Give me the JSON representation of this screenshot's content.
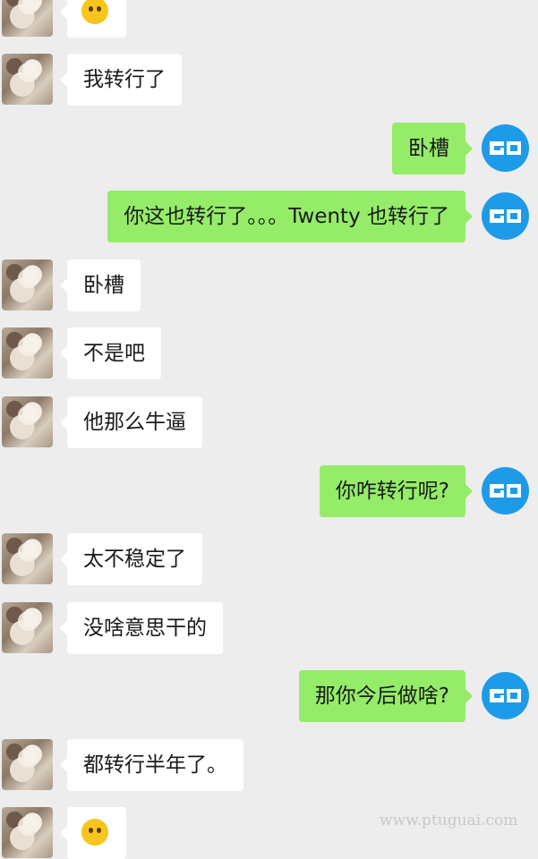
{
  "colors": {
    "background": "#ededed",
    "friend_bubble": "#ffffff",
    "my_bubble": "#95ec69",
    "my_avatar": "#1e9be8"
  },
  "friend_avatar_icon": "plush-toy-avatar",
  "my_avatar_icon": "go-logo-avatar",
  "messages": [
    {
      "side": "left",
      "type": "emoji",
      "emoji": "crying-face-emoji"
    },
    {
      "side": "left",
      "text": "我转行了"
    },
    {
      "side": "right",
      "text": "卧槽"
    },
    {
      "side": "right",
      "text": "你这也转行了。。。Twenty 也转行了"
    },
    {
      "side": "left",
      "text": "卧槽"
    },
    {
      "side": "left",
      "text": "不是吧"
    },
    {
      "side": "left",
      "text": "他那么牛逼"
    },
    {
      "side": "right",
      "text": "你咋转行呢?"
    },
    {
      "side": "left",
      "text": "太不稳定了"
    },
    {
      "side": "left",
      "text": "没啥意思干的"
    },
    {
      "side": "right",
      "text": "那你今后做啥?"
    },
    {
      "side": "left",
      "text": "都转行半年了。"
    },
    {
      "side": "left",
      "type": "emoji",
      "emoji": "crying-face-emoji"
    }
  ],
  "watermark": "www.ptuguai.com"
}
